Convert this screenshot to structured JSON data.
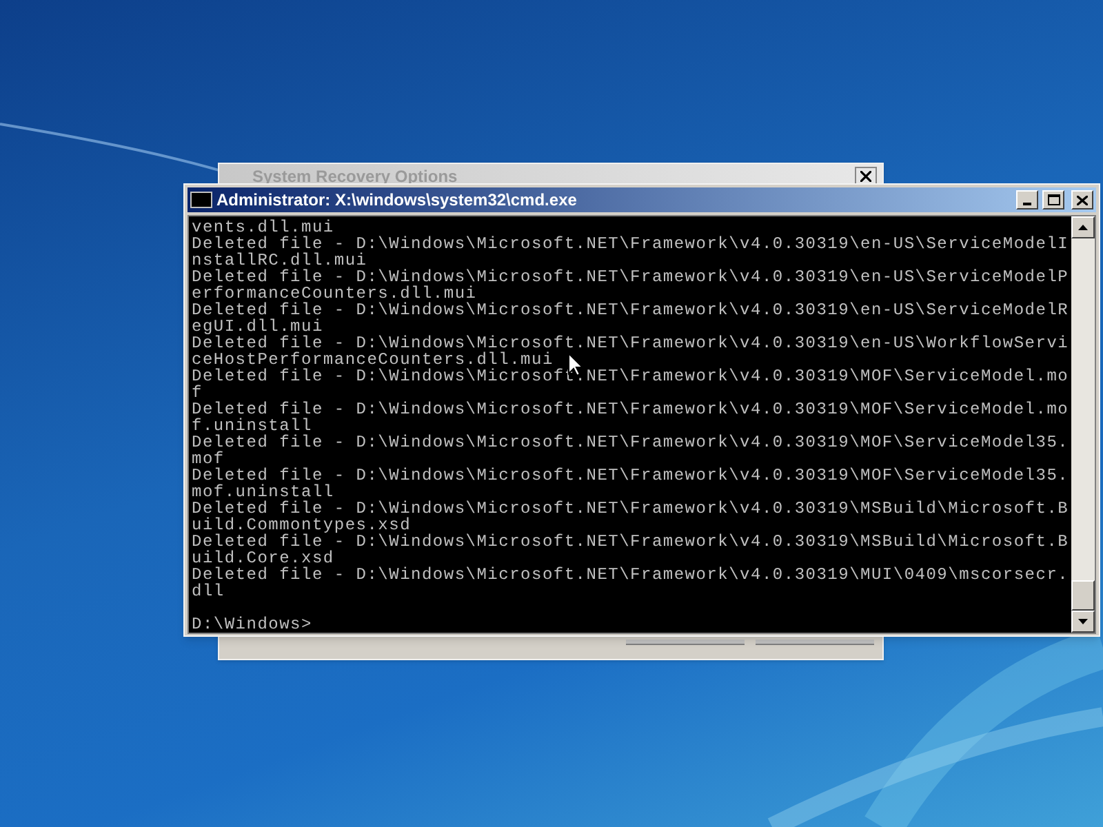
{
  "back_window": {
    "title": "System Recovery Options"
  },
  "console_window": {
    "title": "Administrator: X:\\windows\\system32\\cmd.exe",
    "lines": [
      "vents.dll.mui",
      "Deleted file - D:\\Windows\\Microsoft.NET\\Framework\\v4.0.30319\\en-US\\ServiceModelI",
      "nstallRC.dll.mui",
      "Deleted file - D:\\Windows\\Microsoft.NET\\Framework\\v4.0.30319\\en-US\\ServiceModelP",
      "erformanceCounters.dll.mui",
      "Deleted file - D:\\Windows\\Microsoft.NET\\Framework\\v4.0.30319\\en-US\\ServiceModelR",
      "egUI.dll.mui",
      "Deleted file - D:\\Windows\\Microsoft.NET\\Framework\\v4.0.30319\\en-US\\WorkflowServi",
      "ceHostPerformanceCounters.dll.mui",
      "Deleted file - D:\\Windows\\Microsoft.NET\\Framework\\v4.0.30319\\MOF\\ServiceModel.mo",
      "f",
      "Deleted file - D:\\Windows\\Microsoft.NET\\Framework\\v4.0.30319\\MOF\\ServiceModel.mo",
      "f.uninstall",
      "Deleted file - D:\\Windows\\Microsoft.NET\\Framework\\v4.0.30319\\MOF\\ServiceModel35.",
      "mof",
      "Deleted file - D:\\Windows\\Microsoft.NET\\Framework\\v4.0.30319\\MOF\\ServiceModel35.",
      "mof.uninstall",
      "Deleted file - D:\\Windows\\Microsoft.NET\\Framework\\v4.0.30319\\MSBuild\\Microsoft.B",
      "uild.Commontypes.xsd",
      "Deleted file - D:\\Windows\\Microsoft.NET\\Framework\\v4.0.30319\\MSBuild\\Microsoft.B",
      "uild.Core.xsd",
      "Deleted file - D:\\Windows\\Microsoft.NET\\Framework\\v4.0.30319\\MUI\\0409\\mscorsecr.",
      "dll"
    ],
    "prompt": "D:\\Windows>"
  }
}
